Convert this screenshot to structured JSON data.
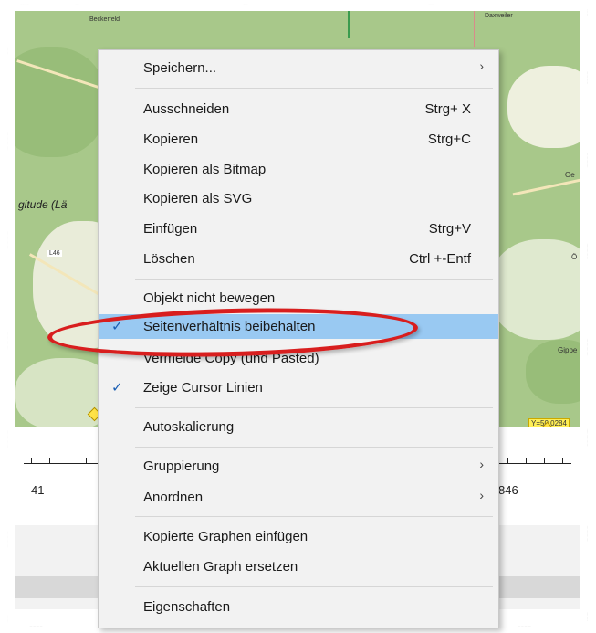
{
  "map": {
    "place_label_1": "Beckerfeld",
    "place_label_2": "Daxweiler",
    "road_label": "L46",
    "y_axis_label": "gitude (Lä",
    "cursor_badge": "Y=50,0284",
    "right_place": "Gippe",
    "right_label_o": "Ö",
    "right_label_oe": "Oe"
  },
  "axis": {
    "left_tick_label": "41",
    "right_tick_label": "846"
  },
  "menu": {
    "items": [
      {
        "label": "Speichern...",
        "shortcut": "",
        "submenu": true,
        "checked": false
      },
      {
        "label": "Ausschneiden",
        "shortcut": "Strg+ X",
        "submenu": false,
        "checked": false
      },
      {
        "label": "Kopieren",
        "shortcut": "Strg+C",
        "submenu": false,
        "checked": false
      },
      {
        "label": "Kopieren als Bitmap",
        "shortcut": "",
        "submenu": false,
        "checked": false
      },
      {
        "label": "Kopieren als SVG",
        "shortcut": "",
        "submenu": false,
        "checked": false
      },
      {
        "label": "Einfügen",
        "shortcut": "Strg+V",
        "submenu": false,
        "checked": false
      },
      {
        "label": "Löschen",
        "shortcut": "Ctrl +-Entf",
        "submenu": false,
        "checked": false
      },
      {
        "label": "Objekt nicht bewegen",
        "shortcut": "",
        "submenu": false,
        "checked": false
      },
      {
        "label": "Seitenverhältnis beibehalten",
        "shortcut": "",
        "submenu": false,
        "checked": true,
        "highlighted": true
      },
      {
        "label": "Vermeide Copy (und Pasted)",
        "shortcut": "",
        "submenu": false,
        "checked": false
      },
      {
        "label": "Zeige Cursor Linien",
        "shortcut": "",
        "submenu": false,
        "checked": true
      },
      {
        "label": "Autoskalierung",
        "shortcut": "",
        "submenu": false,
        "checked": false
      },
      {
        "label": "Gruppierung",
        "shortcut": "",
        "submenu": true,
        "checked": false
      },
      {
        "label": "Anordnen",
        "shortcut": "",
        "submenu": true,
        "checked": false
      },
      {
        "label": "Kopierte Graphen einfügen",
        "shortcut": "",
        "submenu": false,
        "checked": false
      },
      {
        "label": "Aktuellen Graph ersetzen",
        "shortcut": "",
        "submenu": false,
        "checked": false
      },
      {
        "label": "Eigenschaften",
        "shortcut": "",
        "submenu": false,
        "checked": false
      }
    ],
    "submenu_arrow": "›",
    "check_mark": "✓"
  },
  "colors": {
    "highlight": "#99c9f2",
    "annotation": "#d81e1e",
    "map_green": "#a8c88a"
  }
}
